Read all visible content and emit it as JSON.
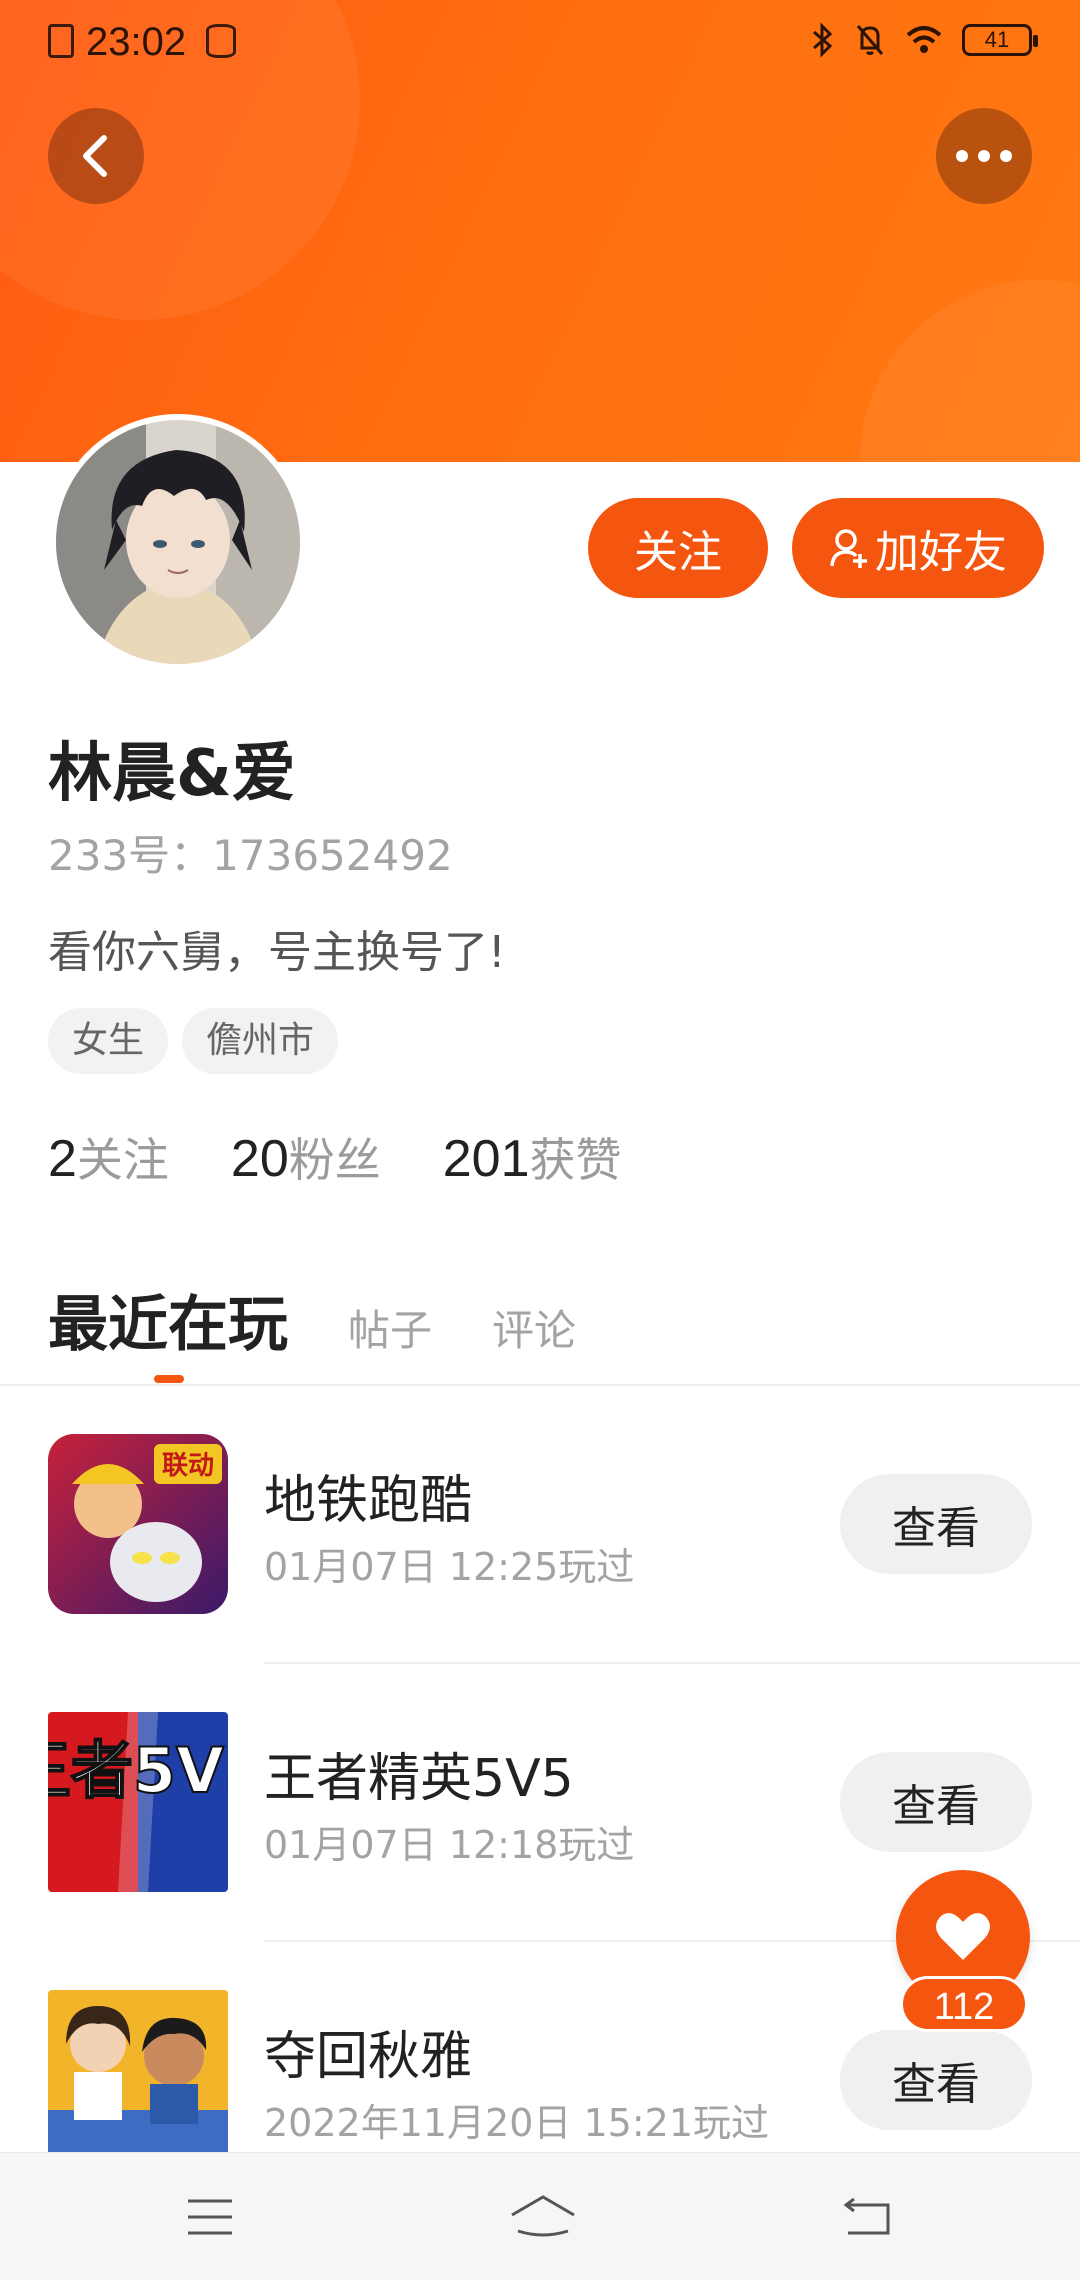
{
  "status_bar": {
    "time": "23:02",
    "battery": "41",
    "icons": [
      "sim-icon",
      "database-icon",
      "bluetooth-icon",
      "mute-icon",
      "wifi-icon",
      "battery-icon"
    ]
  },
  "header": {
    "back_icon": "chevron-left-icon",
    "more_icon": "more-dots-icon",
    "follow_label": "关注",
    "add_friend_label": "加好友"
  },
  "profile": {
    "name": "林晨&爱",
    "uid": "233号：173652492",
    "bio": "看你六舅，号主换号了!",
    "tags": [
      "女生",
      "儋州市"
    ],
    "stats": [
      {
        "num": "2",
        "label": "关注"
      },
      {
        "num": "20",
        "label": "粉丝"
      },
      {
        "num": "201",
        "label": "获赞"
      }
    ]
  },
  "tabs": [
    {
      "label": "最近在玩",
      "active": true
    },
    {
      "label": "帖子",
      "active": false
    },
    {
      "label": "评论",
      "active": false
    }
  ],
  "games": [
    {
      "title": "地铁跑酷",
      "time": "01月07日 12:25玩过",
      "button": "查看",
      "icon_text": "联动"
    },
    {
      "title": "王者精英5V5",
      "time": "01月07日 12:18玩过",
      "button": "查看",
      "icon_text": "王者5V5"
    },
    {
      "title": "夺回秋雅",
      "time": "2022年11月20日 15:21玩过",
      "button": "查看",
      "icon_text": ""
    }
  ],
  "like_fab": {
    "count": "112",
    "icon": "heart-icon"
  },
  "colors": {
    "accent": "#f5560f",
    "banner_start": "#ff5a12",
    "banner_end": "#ff7a12"
  }
}
